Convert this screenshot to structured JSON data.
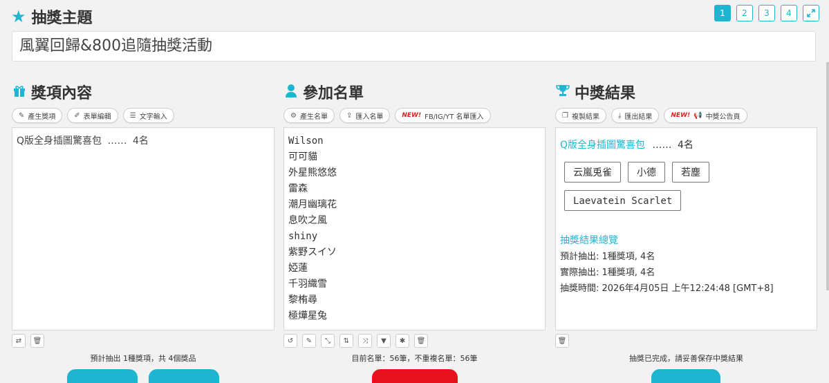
{
  "header": {
    "title": "抽獎主題",
    "pages": [
      "1",
      "2",
      "3",
      "4"
    ],
    "active_page": "1",
    "topic": "風翼回歸&800追隨抽獎活動"
  },
  "prizes": {
    "title": "獎項內容",
    "buttons": [
      "產生獎項",
      "表單編輯",
      "文字輸入"
    ],
    "items": [
      {
        "name": "Q版全身插圖驚喜包",
        "dots": "……",
        "count": "4名"
      }
    ],
    "footer": "預計抽出 1種獎項，共 4個獎品"
  },
  "participants": {
    "title": "參加名單",
    "buttons": [
      "產生名單",
      "匯入名單"
    ],
    "new_badge": "NEW!",
    "import_social": "FB/IG/YT 名單匯入",
    "names": [
      "Wilson",
      "可可貓",
      "外星熊悠悠",
      "雷森",
      "潮月幽璃花",
      "息吹之風",
      "shiny",
      "紫野スイソ",
      "婭蓮",
      "千羽織雪",
      "黎栯尋",
      "極燁星兔"
    ],
    "footer": "目前名單：56筆，不重複名單：56筆"
  },
  "results": {
    "title": "中獎結果",
    "buttons": [
      "複製結果",
      "匯出結果"
    ],
    "new_badge": "NEW!",
    "announce": "中獎公告頁",
    "prize_heading": "Q版全身插圖驚喜包",
    "prize_dots": "……",
    "prize_count": "4名",
    "winners": [
      "云嵐兎雀",
      "小德",
      "若塵",
      "Laevatein Scarlet"
    ],
    "summary_title": "抽獎結果總覽",
    "summary_lines": [
      "預計抽出: 1種獎項, 4名",
      "實際抽出: 1種獎項, 4名",
      "抽獎時間: 2026年4月05日 上午12:24:48 [GMT+8]"
    ],
    "footer": "抽獎已完成，請妥善保存中獎結果"
  },
  "colors": {
    "accent": "#1fb5d0",
    "danger": "#e8121f"
  }
}
